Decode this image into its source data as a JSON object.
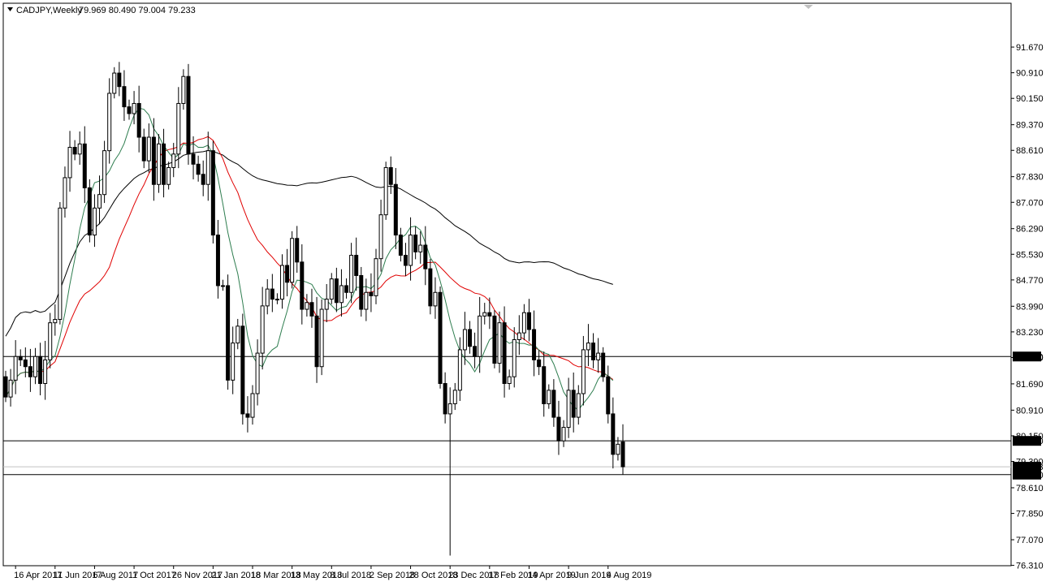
{
  "header": {
    "symbol": "CADJPY,Weekly",
    "ohlc": "79.969 80.490 79.004 79.233"
  },
  "colors": {
    "background": "#ffffff",
    "candle_bull": "#ffffff",
    "candle_bear": "#000000",
    "ma_fast": "#2e7d4f",
    "ma_mid": "#e00000",
    "ma_slow": "#000000",
    "price_tag_bg": "#000000",
    "price_tag_text": "#ffffff"
  },
  "chart_data": {
    "type": "candlestick",
    "symbol": "CADJPY",
    "timeframe": "Weekly",
    "last_ohlc": {
      "open": 79.969,
      "high": 80.49,
      "low": 79.004,
      "close": 79.233
    },
    "ylim": [
      76.3,
      92.2
    ],
    "y_ticks": [
      "91.670",
      "90.910",
      "90.150",
      "89.370",
      "88.610",
      "87.830",
      "87.070",
      "86.290",
      "85.530",
      "84.770",
      "83.990",
      "83.230",
      "82.470",
      "81.690",
      "80.910",
      "80.150",
      "79.390",
      "78.610",
      "77.850",
      "77.070",
      "76.310"
    ],
    "x_ticks": [
      "16 Apr 2017",
      "11 Jun 2017",
      "6 Aug 2017",
      "1 Oct 2017",
      "26 Nov 2017",
      "21 Jan 2018",
      "18 Mar 2018",
      "13 May 2018",
      "8 Jul 2018",
      "2 Sep 2018",
      "28 Oct 2018",
      "23 Dec 2018",
      "17 Feb 2019",
      "14 Apr 2019",
      "9 Jun 2019",
      "4 Aug 2019"
    ],
    "x_tick_bar_index": [
      2,
      10,
      18,
      26,
      34,
      42,
      50,
      58,
      66,
      74,
      82,
      90,
      98,
      106,
      114,
      122
    ],
    "horizontal_lines": [
      {
        "price": 82.5,
        "label": "82.500"
      },
      {
        "price": 80.0,
        "label": "80.000"
      },
      {
        "price": 79.0,
        "label": "79.000"
      }
    ],
    "current_price": {
      "price": 79.233,
      "label": "79.233"
    },
    "closes": [
      81.3,
      81.8,
      82.5,
      82.4,
      82.2,
      81.9,
      82.5,
      81.7,
      82.4,
      83.5,
      83.6,
      86.9,
      87.8,
      88.7,
      88.5,
      88.8,
      87.5,
      86.1,
      86.9,
      87.3,
      88.6,
      90.3,
      90.9,
      90.5,
      89.9,
      89.7,
      90.0,
      89.0,
      88.3,
      89.0,
      87.6,
      88.8,
      87.6,
      88.1,
      88.5,
      90.0,
      90.8,
      88.5,
      88.2,
      87.9,
      87.6,
      88.6,
      86.1,
      84.6,
      84.6,
      81.8,
      82.9,
      83.4,
      80.8,
      80.7,
      81.4,
      82.6,
      84.0,
      84.5,
      84.2,
      84.2,
      85.2,
      84.7,
      86.0,
      85.3,
      83.9,
      84.1,
      83.7,
      82.2,
      83.9,
      84.2,
      84.8,
      84.1,
      84.6,
      84.4,
      85.5,
      84.9,
      83.9,
      84.4,
      84.3,
      85.4,
      86.7,
      88.1,
      87.6,
      86.1,
      85.5,
      85.2,
      86.1,
      85.6,
      85.8,
      85.1,
      84.0,
      84.4,
      81.7,
      80.8,
      81.1,
      81.5,
      82.7,
      83.3,
      82.8,
      82.5,
      83.7,
      83.8,
      83.7,
      82.3,
      83.5,
      81.7,
      81.9,
      83.0,
      83.2,
      83.8,
      83.3,
      82.4,
      82.2,
      81.1,
      81.5,
      80.7,
      80.0,
      80.4,
      81.5,
      80.7,
      81.4,
      82.7,
      82.9,
      82.4,
      82.6,
      81.9,
      80.8,
      79.6,
      79.9,
      79.233
    ]
  }
}
